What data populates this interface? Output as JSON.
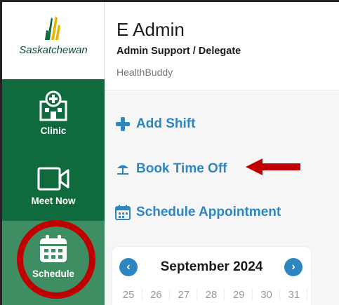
{
  "brand": {
    "logo_text": "Saskatchewan"
  },
  "sidebar": {
    "items": [
      {
        "label": "Clinic",
        "icon": "hospital-icon"
      },
      {
        "label": "Meet Now",
        "icon": "video-camera-icon"
      },
      {
        "label": "Schedule",
        "icon": "calendar-icon"
      }
    ]
  },
  "header": {
    "name": "E Admin",
    "role": "Admin Support / Delegate",
    "app": "HealthBuddy"
  },
  "actions": {
    "add_shift": "Add Shift",
    "book_time_off": "Book Time Off",
    "schedule_appointment": "Schedule Appointment"
  },
  "calendar": {
    "month": "September 2024",
    "days": [
      "25",
      "26",
      "27",
      "28",
      "29",
      "30",
      "31"
    ]
  },
  "colors": {
    "sidebar": "#0f6b3d",
    "sidebar_active": "#3f8d63",
    "accent": "#2e86c1",
    "annotation": "#c00000"
  }
}
